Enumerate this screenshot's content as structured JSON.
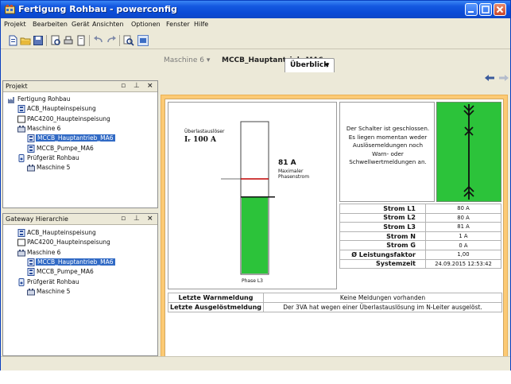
{
  "window": {
    "title": "Fertigung Rohbau - powerconfig",
    "title_color": "#0a4bd6"
  },
  "menu": [
    "Projekt",
    "Bearbeiten",
    "Gerät",
    "Ansichten",
    "Optionen",
    "Fenster",
    "Hilfe"
  ],
  "project_panel": {
    "title": "Projekt",
    "tree": [
      {
        "label": "Fertigung Rohbau",
        "icon": "factory-icon",
        "level": 0
      },
      {
        "label": "ACB_Haupteinspeisung",
        "icon": "breaker-device-icon",
        "level": 1
      },
      {
        "label": "PAC4200_Haupteinspeisung",
        "icon": "meter-device-icon",
        "level": 1
      },
      {
        "label": "Maschine 6",
        "icon": "machine-icon",
        "level": 1
      },
      {
        "label": "MCCB_Hauptantrieb_MA6",
        "icon": "breaker-device-icon",
        "level": 2,
        "selected": true
      },
      {
        "label": "MCCB_Pumpe_MA6",
        "icon": "breaker-device-icon",
        "level": 2
      },
      {
        "label": "Prüfgerät Rohbau",
        "icon": "test-device-icon",
        "level": 1
      },
      {
        "label": "Maschine 5",
        "icon": "machine-icon",
        "level": 2
      }
    ]
  },
  "gateway_panel": {
    "title": "Gateway Hierarchie",
    "tree": [
      {
        "label": "ACB_Haupteinspeisung",
        "icon": "breaker-device-icon",
        "level": 1
      },
      {
        "label": "PAC4200_Haupteinspeisung",
        "icon": "meter-device-icon",
        "level": 1
      },
      {
        "label": "Maschine 6",
        "icon": "machine-icon",
        "level": 1
      },
      {
        "label": "MCCB_Hauptantrieb_MA6",
        "icon": "breaker-device-icon",
        "level": 2,
        "selected": true
      },
      {
        "label": "MCCB_Pumpe_MA6",
        "icon": "breaker-device-icon",
        "level": 2
      },
      {
        "label": "Prüfgerät Rohbau",
        "icon": "test-device-icon",
        "level": 1
      },
      {
        "label": "Maschine 5",
        "icon": "machine-icon",
        "level": 2
      }
    ]
  },
  "breadcrumb": {
    "parent": "Maschine 6",
    "current": "MCCB_Hauptantrieb_MA6"
  },
  "view_tab": "Überblick",
  "gauge": {
    "threshold_label": "Überlastauslöser",
    "threshold_value": "Iᵣ 100 A",
    "threshold_amps": 100,
    "current_value": "81 A",
    "current_amps": 81,
    "current_label_line1": "Maximaler",
    "current_label_line2": "Phasenstrom",
    "phase_label": "Phase L3",
    "fill_color": "#2cc33a",
    "threshold_color": "#c00000"
  },
  "status_text": "Der Schalter ist geschlossen. Es liegen momentan weder Auslösemeldungen noch Warn- oder Schwellwertmeldungen an.",
  "breaker_state": "closed",
  "breaker_color": "#2cc33a",
  "measurements": [
    {
      "label": "Strom L1",
      "value": "80 A"
    },
    {
      "label": "Strom L2",
      "value": "80 A"
    },
    {
      "label": "Strom L3",
      "value": "81 A"
    },
    {
      "label": "Strom N",
      "value": "1 A"
    },
    {
      "label": "Strom G",
      "value": "0 A"
    },
    {
      "label": "Ø Leistungsfaktor",
      "value": "1,00"
    },
    {
      "label": "Systemzeit",
      "value": "24.09.2015 12:53:42"
    }
  ],
  "messages": [
    {
      "label": "Letzte Warnmeldung",
      "value": "Keine Meldungen vorhanden"
    },
    {
      "label": "Letzte Ausgelöstmeldung",
      "value": "Der 3VA hat wegen einer Überlastauslösung im N-Leiter ausgelöst."
    }
  ],
  "accent_frame_color": "#fcca74"
}
